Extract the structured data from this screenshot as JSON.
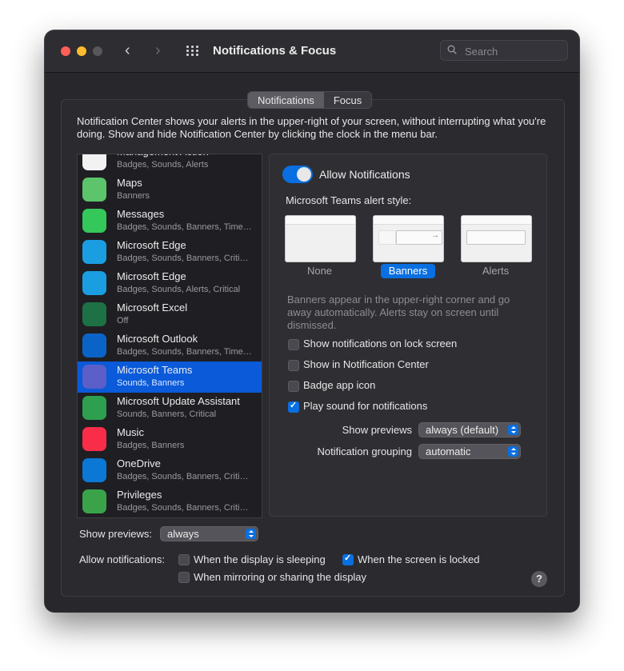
{
  "window": {
    "title": "Notifications & Focus",
    "search_placeholder": "Search"
  },
  "tabs": [
    {
      "label": "Notifications",
      "active": true
    },
    {
      "label": "Focus",
      "active": false
    }
  ],
  "description": "Notification Center shows your alerts in the upper-right of your screen, without interrupting what you're doing. Show and hide Notification Center by clicking the clock in the menu bar.",
  "apps": [
    {
      "name": "Management Action",
      "sub": "Badges, Sounds, Alerts",
      "icon": "management-action-icon",
      "color": "#f2f2f2"
    },
    {
      "name": "Maps",
      "sub": "Banners",
      "icon": "maps-icon",
      "color": "#5cc46a"
    },
    {
      "name": "Messages",
      "sub": "Badges, Sounds, Banners, Time…",
      "icon": "messages-icon",
      "color": "#34c759"
    },
    {
      "name": "Microsoft Edge",
      "sub": "Badges, Sounds, Banners, Criti…",
      "icon": "edge-icon",
      "color": "#1b9de2"
    },
    {
      "name": "Microsoft Edge",
      "sub": "Badges, Sounds, Alerts, Critical",
      "icon": "edge-icon",
      "color": "#1b9de2"
    },
    {
      "name": "Microsoft Excel",
      "sub": "Off",
      "icon": "excel-icon",
      "color": "#1e7145"
    },
    {
      "name": "Microsoft Outlook",
      "sub": "Badges, Sounds, Banners, Time…",
      "icon": "outlook-icon",
      "color": "#0a64c8"
    },
    {
      "name": "Microsoft Teams",
      "sub": "Sounds, Banners",
      "icon": "teams-icon",
      "color": "#5b5fc7",
      "selected": true
    },
    {
      "name": "Microsoft Update Assistant",
      "sub": "Sounds, Banners, Critical",
      "icon": "update-assistant-icon",
      "color": "#2e9e4f"
    },
    {
      "name": "Music",
      "sub": "Badges, Banners",
      "icon": "music-icon",
      "color": "#fa2d48"
    },
    {
      "name": "OneDrive",
      "sub": "Badges, Sounds, Banners, Criti…",
      "icon": "onedrive-icon",
      "color": "#0a78d4"
    },
    {
      "name": "Privileges",
      "sub": "Badges, Sounds, Banners, Criti…",
      "icon": "privileges-icon",
      "color": "#3aa34a"
    }
  ],
  "detail": {
    "allow_label": "Allow Notifications",
    "allow_on": true,
    "style_label": "Microsoft Teams alert style:",
    "styles": [
      {
        "label": "None",
        "selected": false
      },
      {
        "label": "Banners",
        "selected": true
      },
      {
        "label": "Alerts",
        "selected": false
      }
    ],
    "explain": "Banners appear in the upper-right corner and go away automatically. Alerts stay on screen until dismissed.",
    "checkboxes": [
      {
        "label": "Show notifications on lock screen",
        "checked": false
      },
      {
        "label": "Show in Notification Center",
        "checked": false
      },
      {
        "label": "Badge app icon",
        "checked": false
      },
      {
        "label": "Play sound for notifications",
        "checked": true
      }
    ],
    "show_previews_label": "Show previews",
    "show_previews_value": "always (default)",
    "grouping_label": "Notification grouping",
    "grouping_value": "automatic"
  },
  "bottom": {
    "show_previews_label": "Show previews:",
    "show_previews_value": "always",
    "allow_label": "Allow notifications:",
    "opt_sleeping": "When the display is sleeping",
    "opt_sleeping_checked": false,
    "opt_locked": "When the screen is locked",
    "opt_locked_checked": true,
    "opt_mirroring": "When mirroring or sharing the display",
    "opt_mirroring_checked": false,
    "help": "?"
  },
  "colors": {
    "accent": "#0a6fe0",
    "selection": "#0a5ad9"
  }
}
